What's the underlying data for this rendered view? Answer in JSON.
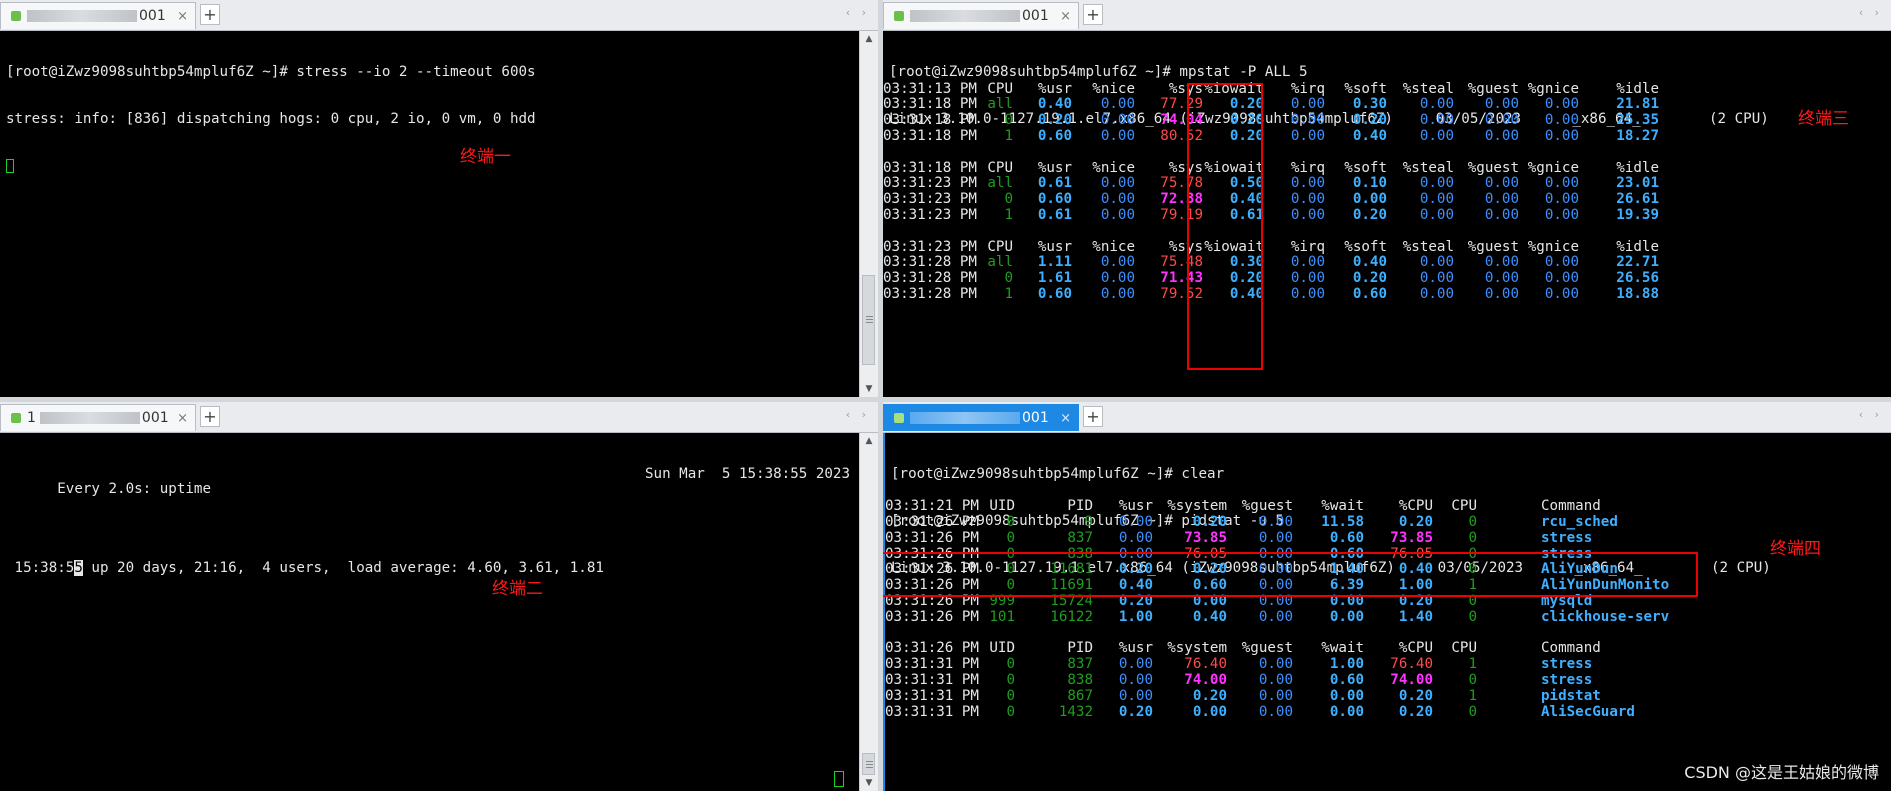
{
  "tabs": {
    "t1": {
      "suffix": "001",
      "close": "×",
      "add": "+",
      "arrows": "‹ ›"
    },
    "t2": {
      "prefix": "1",
      "suffix": "001",
      "close": "×",
      "add": "+",
      "arrows": "‹ ›"
    },
    "t3": {
      "suffix": "001",
      "close": "×",
      "add": "+",
      "arrows": "‹ ›"
    },
    "t4": {
      "suffix": "001",
      "close": "×",
      "add": "+",
      "arrows": "‹ ›"
    }
  },
  "term1": {
    "lines": [
      "[root@iZwz9098suhtbp54mpluf6Z ~]# stress --io 2 --timeout 600s",
      "stress: info: [836] dispatching hogs: 0 cpu, 2 io, 0 vm, 0 hdd"
    ],
    "label": "终端一"
  },
  "term2": {
    "header_left": "Every 2.0s: uptime",
    "header_right": "Sun Mar  5 15:38:55 2023",
    "uptime_a": " 15:38:5",
    "uptime_cursor": "5",
    "uptime_b": " up 20 days, 21:16,  4 users,  load average: 4.60, 3.61, 1.81",
    "label": "终端二"
  },
  "term3": {
    "prompt": "[root@iZwz9098suhtbp54mpluf6Z ~]# mpstat -P ALL 5",
    "sysinfo": "Linux 3.10.0-1127.19.1.el7.x86_64 (iZwz9098suhtbp54mpluf6Z)     03/05/2023      _x86_64_        (2 CPU)",
    "headers": [
      "CPU",
      "%usr",
      "%nice",
      "%sys",
      "%iowait",
      "%irq",
      "%soft",
      "%steal",
      "%guest",
      "%gnice",
      "%idle"
    ],
    "groups": [
      {
        "header_time": "03:31:13 PM",
        "rows": [
          {
            "time": "03:31:18 PM",
            "cpu": "all",
            "usr": "0.40",
            "nice": "0.00",
            "sys": "77.29",
            "iowait": "0.20",
            "irq": "0.00",
            "soft": "0.30",
            "steal": "0.00",
            "guest": "0.00",
            "gnice": "0.00",
            "idle": "21.81"
          },
          {
            "time": "03:31:18 PM",
            "cpu": "0",
            "usr": "0.20",
            "nice": "0.00",
            "sys": "74.04",
            "iowait": "0.20",
            "irq": "0.00",
            "soft": "0.20",
            "steal": "0.00",
            "guest": "0.00",
            "gnice": "0.00",
            "idle": "25.35"
          },
          {
            "time": "03:31:18 PM",
            "cpu": "1",
            "usr": "0.60",
            "nice": "0.00",
            "sys": "80.52",
            "iowait": "0.20",
            "irq": "0.00",
            "soft": "0.40",
            "steal": "0.00",
            "guest": "0.00",
            "gnice": "0.00",
            "idle": "18.27"
          }
        ]
      },
      {
        "header_time": "03:31:18 PM",
        "rows": [
          {
            "time": "03:31:23 PM",
            "cpu": "all",
            "usr": "0.61",
            "nice": "0.00",
            "sys": "75.78",
            "iowait": "0.50",
            "irq": "0.00",
            "soft": "0.10",
            "steal": "0.00",
            "guest": "0.00",
            "gnice": "0.00",
            "idle": "23.01"
          },
          {
            "time": "03:31:23 PM",
            "cpu": "0",
            "usr": "0.60",
            "nice": "0.00",
            "sys": "72.38",
            "iowait": "0.40",
            "irq": "0.00",
            "soft": "0.00",
            "steal": "0.00",
            "guest": "0.00",
            "gnice": "0.00",
            "idle": "26.61"
          },
          {
            "time": "03:31:23 PM",
            "cpu": "1",
            "usr": "0.61",
            "nice": "0.00",
            "sys": "79.19",
            "iowait": "0.61",
            "irq": "0.00",
            "soft": "0.20",
            "steal": "0.00",
            "guest": "0.00",
            "gnice": "0.00",
            "idle": "19.39"
          }
        ]
      },
      {
        "header_time": "03:31:23 PM",
        "rows": [
          {
            "time": "03:31:28 PM",
            "cpu": "all",
            "usr": "1.11",
            "nice": "0.00",
            "sys": "75.48",
            "iowait": "0.30",
            "irq": "0.00",
            "soft": "0.40",
            "steal": "0.00",
            "guest": "0.00",
            "gnice": "0.00",
            "idle": "22.71"
          },
          {
            "time": "03:31:28 PM",
            "cpu": "0",
            "usr": "1.61",
            "nice": "0.00",
            "sys": "71.43",
            "iowait": "0.20",
            "irq": "0.00",
            "soft": "0.20",
            "steal": "0.00",
            "guest": "0.00",
            "gnice": "0.00",
            "idle": "26.56"
          },
          {
            "time": "03:31:28 PM",
            "cpu": "1",
            "usr": "0.60",
            "nice": "0.00",
            "sys": "79.52",
            "iowait": "0.40",
            "irq": "0.00",
            "soft": "0.60",
            "steal": "0.00",
            "guest": "0.00",
            "gnice": "0.00",
            "idle": "18.88"
          }
        ]
      }
    ],
    "label": "终端三"
  },
  "term4": {
    "lines": [
      "[root@iZwz9098suhtbp54mpluf6Z ~]# clear",
      "[root@iZwz9098suhtbp54mpluf6Z ~]# pidstat -u 5",
      "Linux 3.10.0-1127.19.1.el7.x86_64 (iZwz9098suhtbp54mpluf6Z)     03/05/2023      _x86_64_        (2 CPU)"
    ],
    "headers": [
      "UID",
      "PID",
      "%usr",
      "%system",
      "%guest",
      "%wait",
      "%CPU",
      "CPU",
      "Command"
    ],
    "groups": [
      {
        "header_time": "03:31:21 PM",
        "rows": [
          {
            "time": "03:31:26 PM",
            "uid": "0",
            "pid": "9",
            "usr": "0.00",
            "system": "0.20",
            "guest": "0.00",
            "wait": "11.58",
            "cpu_pct": "0.20",
            "cpu": "0",
            "cmd": "rcu_sched"
          },
          {
            "time": "03:31:26 PM",
            "uid": "0",
            "pid": "837",
            "usr": "0.00",
            "system": "73.85",
            "guest": "0.00",
            "wait": "0.60",
            "cpu_pct": "73.85",
            "cpu": "0",
            "cmd": "stress"
          },
          {
            "time": "03:31:26 PM",
            "uid": "0",
            "pid": "838",
            "usr": "0.00",
            "system": "76.05",
            "guest": "0.00",
            "wait": "0.60",
            "cpu_pct": "76.05",
            "cpu": "0",
            "cmd": "stress"
          },
          {
            "time": "03:31:26 PM",
            "uid": "0",
            "pid": "11681",
            "usr": "0.20",
            "system": "0.20",
            "guest": "0.00",
            "wait": "1.40",
            "cpu_pct": "0.40",
            "cpu": "0",
            "cmd": "AliYunDun"
          },
          {
            "time": "03:31:26 PM",
            "uid": "0",
            "pid": "11691",
            "usr": "0.40",
            "system": "0.60",
            "guest": "0.00",
            "wait": "6.39",
            "cpu_pct": "1.00",
            "cpu": "1",
            "cmd": "AliYunDunMonito"
          },
          {
            "time": "03:31:26 PM",
            "uid": "999",
            "pid": "15724",
            "usr": "0.20",
            "system": "0.00",
            "guest": "0.00",
            "wait": "0.00",
            "cpu_pct": "0.20",
            "cpu": "0",
            "cmd": "mysqld"
          },
          {
            "time": "03:31:26 PM",
            "uid": "101",
            "pid": "16122",
            "usr": "1.00",
            "system": "0.40",
            "guest": "0.00",
            "wait": "0.00",
            "cpu_pct": "1.40",
            "cpu": "0",
            "cmd": "clickhouse-serv"
          }
        ]
      },
      {
        "header_time": "03:31:26 PM",
        "rows": [
          {
            "time": "03:31:31 PM",
            "uid": "0",
            "pid": "837",
            "usr": "0.00",
            "system": "76.40",
            "guest": "0.00",
            "wait": "1.00",
            "cpu_pct": "76.40",
            "cpu": "1",
            "cmd": "stress"
          },
          {
            "time": "03:31:31 PM",
            "uid": "0",
            "pid": "838",
            "usr": "0.00",
            "system": "74.00",
            "guest": "0.00",
            "wait": "0.60",
            "cpu_pct": "74.00",
            "cpu": "0",
            "cmd": "stress"
          },
          {
            "time": "03:31:31 PM",
            "uid": "0",
            "pid": "867",
            "usr": "0.00",
            "system": "0.20",
            "guest": "0.00",
            "wait": "0.00",
            "cpu_pct": "0.20",
            "cpu": "1",
            "cmd": "pidstat"
          },
          {
            "time": "03:31:31 PM",
            "uid": "0",
            "pid": "1432",
            "usr": "0.20",
            "system": "0.00",
            "guest": "0.00",
            "wait": "0.00",
            "cpu_pct": "0.20",
            "cpu": "0",
            "cmd": "AliSecGuard"
          }
        ]
      }
    ],
    "label": "终端四"
  },
  "watermark": "CSDN @这是王姑娘的微博",
  "colors": {
    "label_red": "#ff1a1a",
    "box_red": "#e00000",
    "active_tab": "#1e88e5",
    "cursor_green": "#19d11f"
  }
}
